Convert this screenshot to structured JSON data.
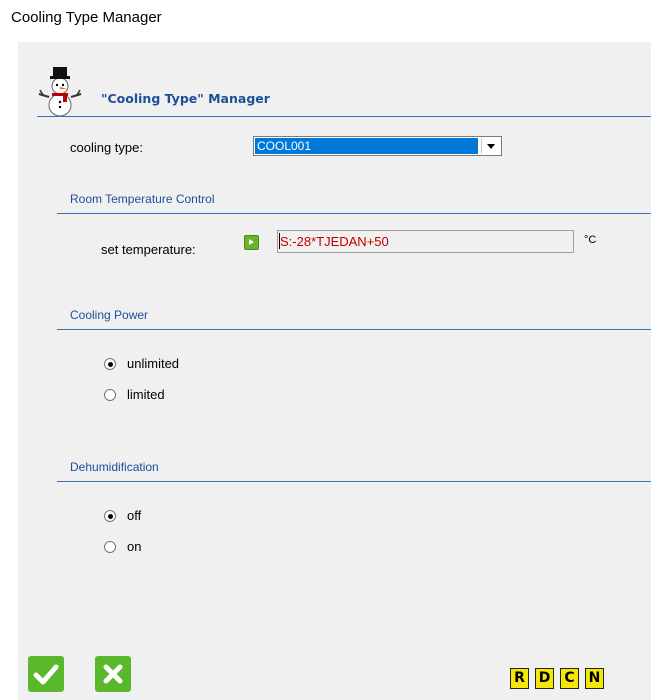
{
  "window": {
    "title": "Cooling Type Manager"
  },
  "manager": {
    "title": "\"Cooling Type\" Manager",
    "logo_icon": "snowman-icon"
  },
  "cooling_type": {
    "label": "cooling type:",
    "selected": "COOL001"
  },
  "room_temperature": {
    "section_title": "Room Temperature Control",
    "set_label": "set temperature:",
    "value": "S:-28*TJEDAN+50",
    "unit": "°C"
  },
  "cooling_power": {
    "section_title": "Cooling Power",
    "options": [
      {
        "label": "unlimited",
        "checked": true
      },
      {
        "label": "limited",
        "checked": false
      }
    ]
  },
  "dehumidification": {
    "section_title": "Dehumidification",
    "options": [
      {
        "label": "off",
        "checked": true
      },
      {
        "label": "on",
        "checked": false
      }
    ]
  },
  "footer": {
    "ok_icon": "checkmark-icon",
    "cancel_icon": "x-icon",
    "buttons": [
      "R",
      "D",
      "C",
      "N"
    ]
  },
  "colors": {
    "accent": "#1d4e99",
    "ok_green": "#5ab82c",
    "value_red": "#c00000",
    "selection_blue": "#0078d7",
    "letter_button_yellow": "#f5e800"
  }
}
